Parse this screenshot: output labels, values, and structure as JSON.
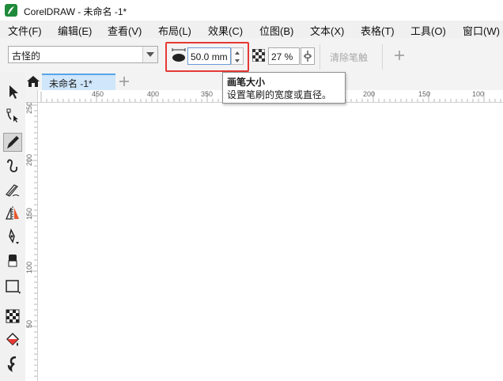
{
  "window": {
    "title": "CorelDRAW - 未命名 -1*"
  },
  "menu": [
    {
      "label": "文件(F)"
    },
    {
      "label": "编辑(E)"
    },
    {
      "label": "查看(V)"
    },
    {
      "label": "布局(L)"
    },
    {
      "label": "效果(C)"
    },
    {
      "label": "位图(B)"
    },
    {
      "label": "文本(X)"
    },
    {
      "label": "表格(T)"
    },
    {
      "label": "工具(O)"
    },
    {
      "label": "窗口(W)"
    }
  ],
  "property_bar": {
    "brush_preset": "古怪的",
    "brush_size": "50.0 mm",
    "transparency": "27 %",
    "clear_strokes_label": "清除笔触"
  },
  "tooltip": {
    "title": "画笔大小",
    "description": "设置笔刷的宽度或直径。"
  },
  "tabs": [
    {
      "label": "未命名 -1*"
    }
  ],
  "ruler": {
    "horizontal_labels": [
      "450",
      "400",
      "350",
      "200",
      "150",
      "100"
    ],
    "vertical_labels": [
      "250",
      "200",
      "150",
      "100",
      "50"
    ]
  },
  "colors": {
    "highlight": "#e53935",
    "active_tab": "#cfe6fb",
    "app_icon": "#1f8a3a"
  }
}
